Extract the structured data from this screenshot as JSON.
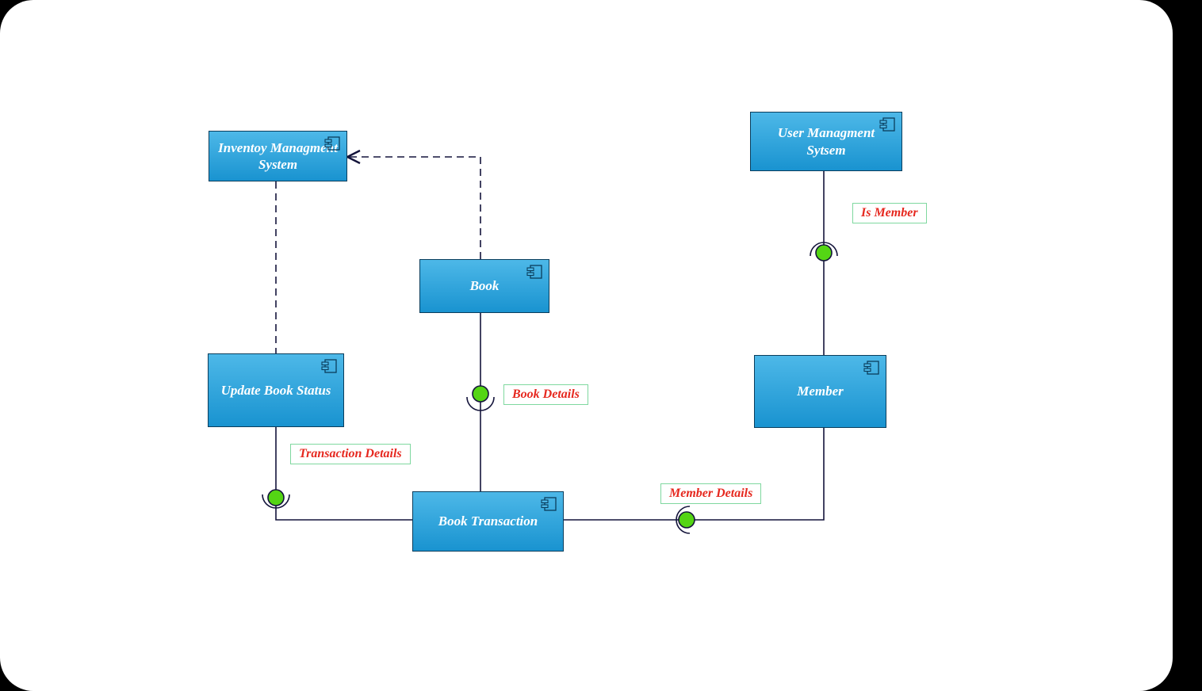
{
  "diagram": {
    "type": "UML Component Diagram",
    "components": {
      "inventory": {
        "label": "Inventoy Managment System"
      },
      "book": {
        "label": "Book"
      },
      "updateBook": {
        "label": "Update Book Status"
      },
      "bookTransaction": {
        "label": "Book Transaction"
      },
      "userMgmt": {
        "label": "User Managment Sytsem"
      },
      "member": {
        "label": "Member"
      }
    },
    "interfaces": {
      "transactionDetails": {
        "label": "Transaction Details"
      },
      "bookDetails": {
        "label": "Book Details"
      },
      "memberDetails": {
        "label": "Member Details"
      },
      "isMember": {
        "label": "Is Member"
      }
    },
    "colors": {
      "componentFillTop": "#4db8e8",
      "componentFillBottom": "#1993d0",
      "componentBorder": "#0a3d5c",
      "labelBorder": "#7fd89f",
      "labelText": "#e6281f",
      "ballFill": "#54d514",
      "line": "#14143b"
    },
    "connectors": [
      {
        "from": "book",
        "to": "inventory",
        "style": "dashed-dependency-arrow"
      },
      {
        "from": "updateBook",
        "to": "inventory",
        "style": "dashed-dependency"
      },
      {
        "from": "book",
        "to": "bookTransaction",
        "style": "ball-socket",
        "interface": "bookDetails"
      },
      {
        "from": "bookTransaction",
        "to": "updateBook",
        "style": "ball-socket",
        "interface": "transactionDetails"
      },
      {
        "from": "bookTransaction",
        "to": "member",
        "style": "ball-socket",
        "interface": "memberDetails"
      },
      {
        "from": "member",
        "to": "userMgmt",
        "style": "ball-socket",
        "interface": "isMember"
      }
    ]
  }
}
